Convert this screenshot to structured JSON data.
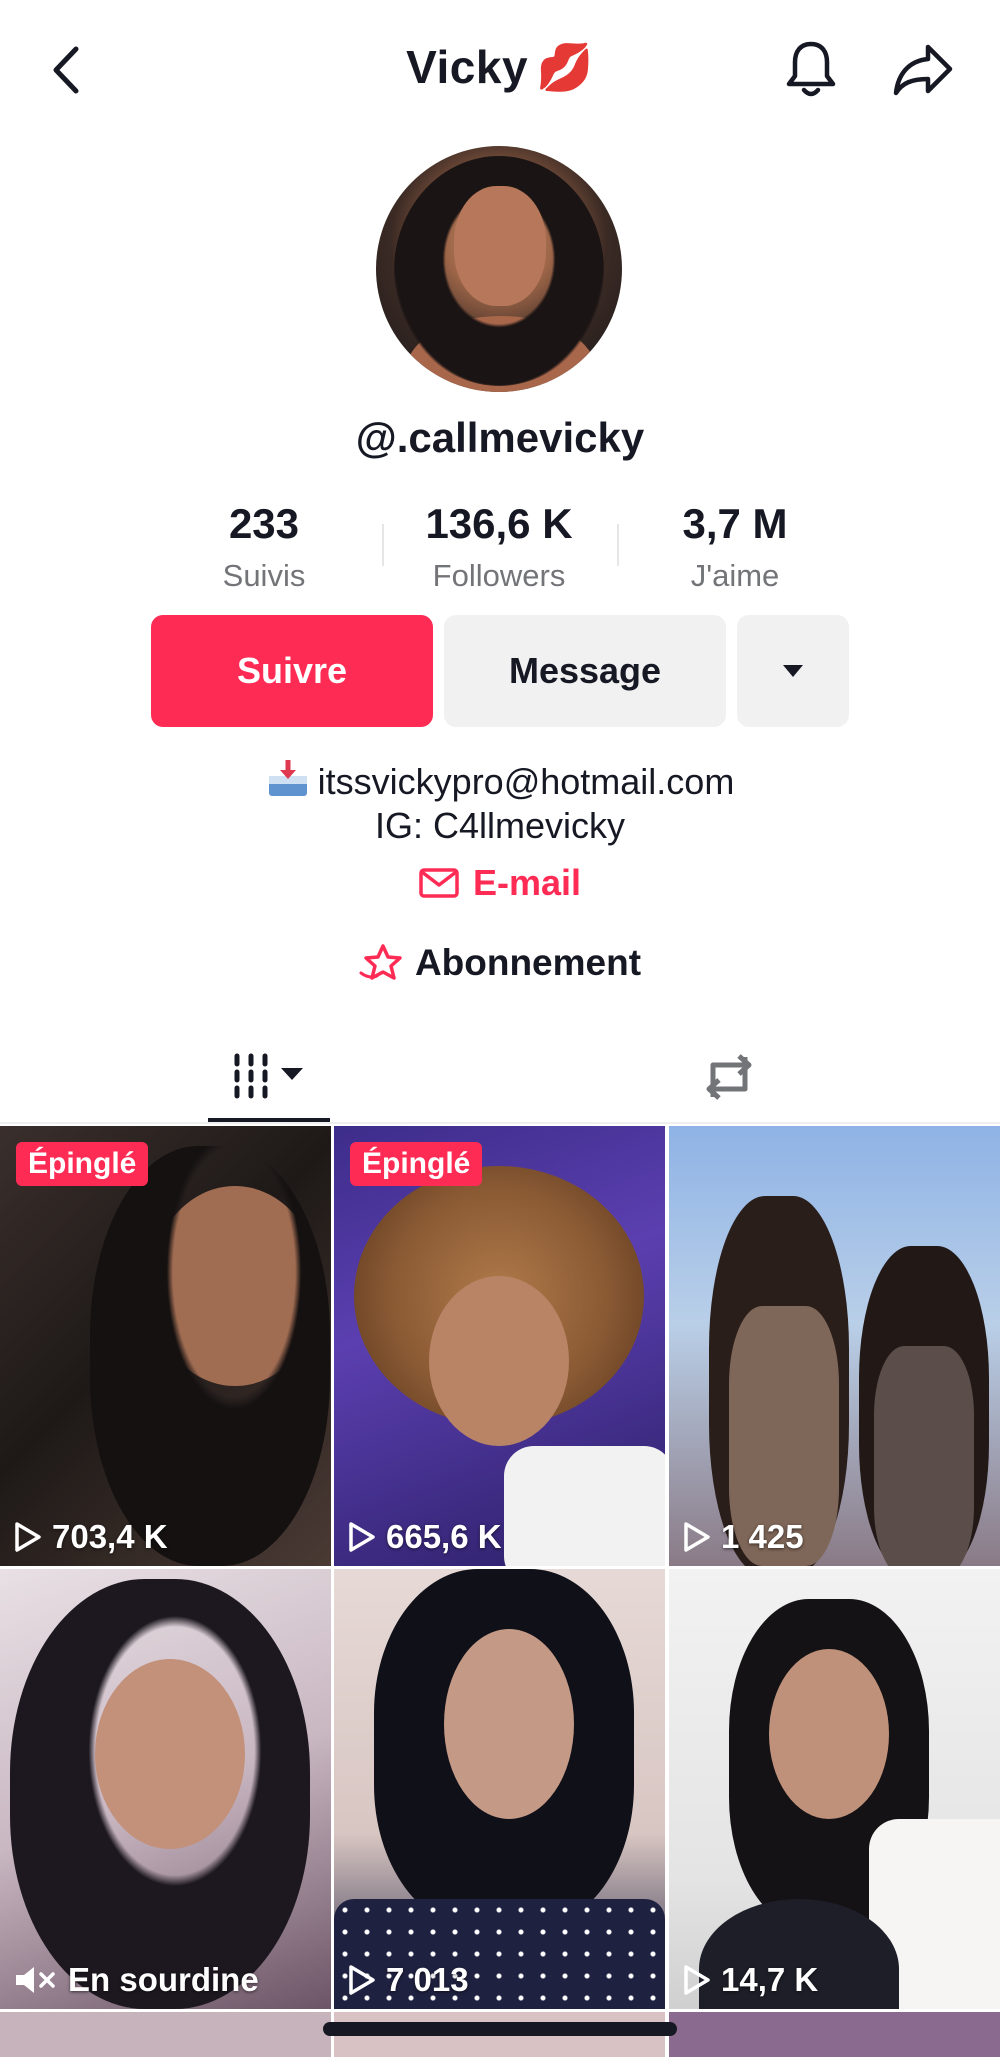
{
  "header": {
    "title": "Vicky",
    "title_emoji": "💋",
    "back_icon": "chevron-left-icon",
    "bell_icon": "bell-icon",
    "share_icon": "share-arrow-icon"
  },
  "profile": {
    "handle": "@.callmevicky",
    "stats": [
      {
        "value": "233",
        "label": "Suivis"
      },
      {
        "value": "136,6 K",
        "label": "Followers"
      },
      {
        "value": "3,7 M",
        "label": "J'aime"
      }
    ]
  },
  "actions": {
    "follow_label": "Suivre",
    "message_label": "Message",
    "more_icon": "caret-down-icon"
  },
  "bio": {
    "line1": "itssvickypro@hotmail.com",
    "line2": "IG: C4llmevicky",
    "email_link": "E-mail",
    "subscription": "Abonnement"
  },
  "tabs": {
    "videos_icon": "videos-grid-icon",
    "reposts_icon": "repost-icon"
  },
  "videos": [
    {
      "pinned_label": "Épinglé",
      "views": "703,4 K"
    },
    {
      "pinned_label": "Épinglé",
      "views": "665,6 K"
    },
    {
      "views": "1 425"
    },
    {
      "views": "En sourdine"
    },
    {
      "views": "7 013"
    },
    {
      "views": "14,7 K"
    }
  ],
  "colors": {
    "accent": "#fe2c55",
    "text": "#161823",
    "muted": "#737478",
    "button_bg": "#f1f1f2"
  }
}
